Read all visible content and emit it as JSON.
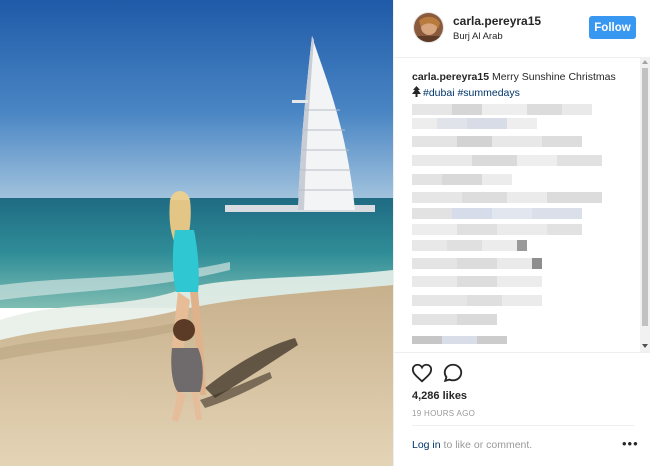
{
  "post": {
    "username": "carla.pereyra15",
    "location": "Burj Al Arab",
    "follow_label": "Follow",
    "caption": {
      "username": "carla.pereyra15",
      "text": " Merry Sunshine Christmas",
      "tags": [
        "#dubai",
        "#summedays"
      ]
    },
    "likes": "4,286 likes",
    "timestamp": "19 HOURS AGO",
    "login_link": "Log in",
    "login_suffix": " to like or comment.",
    "more_label": "•••"
  },
  "icons": [
    "heart-icon",
    "comment-icon",
    "christmas-tree-icon",
    "more-options-icon"
  ],
  "colors": {
    "follow_button": "#3897f0",
    "link": "#003569",
    "muted_text": "#999999",
    "text": "#262626"
  }
}
